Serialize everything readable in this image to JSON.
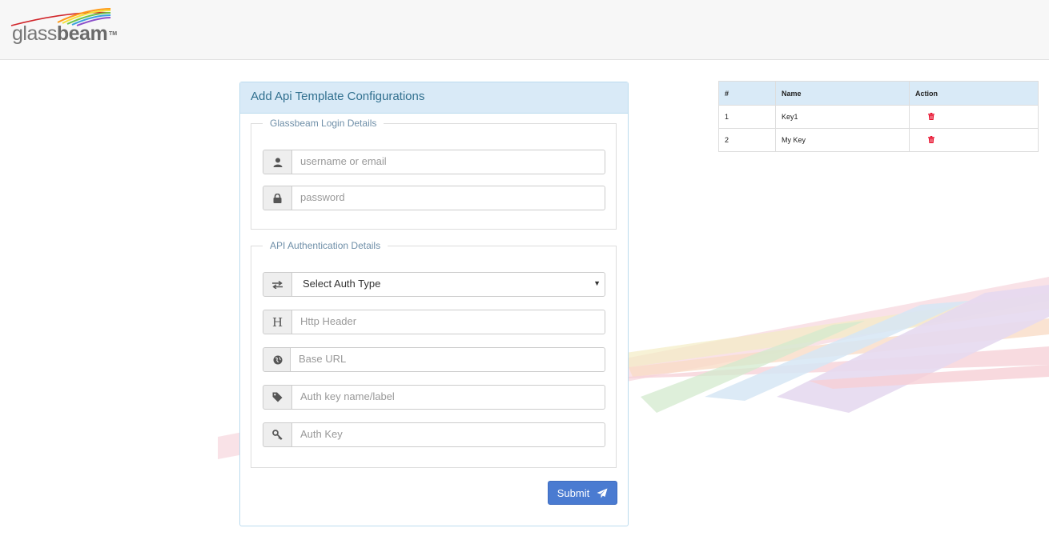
{
  "brand": {
    "name_light": "glass",
    "name_bold": "beam",
    "tm": "TM"
  },
  "form": {
    "title": "Add Api Template Configurations",
    "login_section": {
      "legend": "Glassbeam Login Details",
      "username_placeholder": "username or email",
      "password_placeholder": "password"
    },
    "api_section": {
      "legend": "API Authentication Details",
      "auth_type_value": "Select Auth Type",
      "http_header_placeholder": "Http Header",
      "base_url_placeholder": "Base URL",
      "auth_key_name_placeholder": "Auth key name/label",
      "auth_key_placeholder": "Auth Key"
    },
    "submit_label": "Submit"
  },
  "table": {
    "headers": [
      "#",
      "Name",
      "Action"
    ],
    "rows": [
      {
        "index": "1",
        "name": "Key1"
      },
      {
        "index": "2",
        "name": "My Key"
      }
    ]
  },
  "icons": {
    "username": "user-icon",
    "password": "lock-icon",
    "auth_type": "exchange-arrows-icon",
    "http_header": "header-h-icon",
    "base_url": "globe-icon",
    "auth_key_name": "tag-icon",
    "auth_key": "key-icon",
    "submit": "paper-plane-icon",
    "delete": "trash-icon"
  },
  "colors": {
    "header_bg": "#d9eaf7",
    "header_text": "#31708f",
    "submit_bg": "#4a7bd1",
    "delete_icon": "#e8102d"
  }
}
